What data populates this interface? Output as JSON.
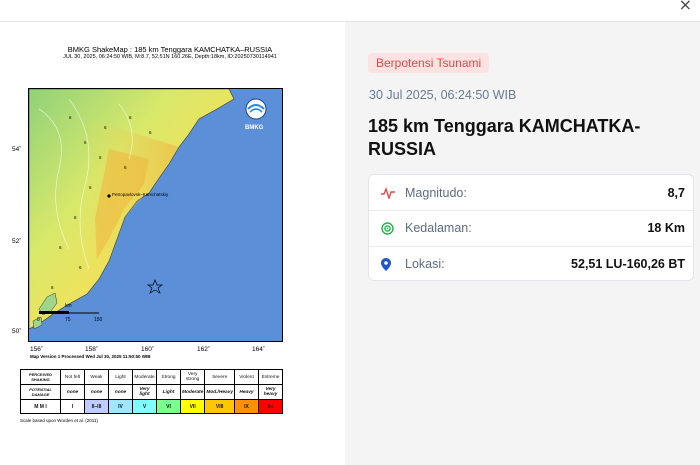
{
  "window": {
    "close_label": "×"
  },
  "shakemap": {
    "title": "BMKG ShakeMap : 185 km Tenggara KAMCHATKA–RUSSIA",
    "subtitle": "JUL 30, 2025, 06:24:50 WIB, M:8.7, 52.51N 160.26E, Depth:18km, ID:20250730114941",
    "logo_text": "BMKG",
    "city_label": "Petropavlovsk–Kamchatskiy",
    "scalebar_unit": "km",
    "scalebar_ticks": [
      "0",
      "75",
      "150"
    ],
    "lat_labels": [
      "54˚",
      "52˚",
      "50˚"
    ],
    "lon_labels": [
      "156˚",
      "158˚",
      "160˚",
      "162˚",
      "164˚"
    ],
    "contour_labels": [
      "6",
      "6",
      "6",
      "6",
      "6",
      "6",
      "6",
      "6",
      "6",
      "6",
      "6",
      "6"
    ],
    "processed_note": "Map Version 1 Processed Wed Jul 30, 2025 11:50:50 WIB",
    "scale_note": "Scale based upon Worden et al. (2011)",
    "legend": {
      "row_headers": [
        "PERCEIVED SHAKING",
        "POTENTIAL DAMAGE",
        "M M I"
      ],
      "shaking": [
        "Not felt",
        "Weak",
        "Light",
        "Moderate",
        "Strong",
        "Very strong",
        "Severe",
        "Violent",
        "Extreme"
      ],
      "damage": [
        "none",
        "none",
        "none",
        "Very light",
        "Light",
        "Moderate",
        "Mod./Heavy",
        "Heavy",
        "Very heavy"
      ],
      "mmi": [
        "I",
        "II–III",
        "IV",
        "V",
        "VI",
        "VII",
        "VIII",
        "IX",
        "X+"
      ],
      "mmi_colors": [
        "#ffffff",
        "#bfccff",
        "#a0e6ff",
        "#80ffff",
        "#7aff93",
        "#ffff00",
        "#ffc800",
        "#ff9100",
        "#ff0000"
      ]
    }
  },
  "event": {
    "badge": "Berpotensi Tsunami",
    "datetime": "30 Jul 2025, 06:24:50 WIB",
    "title": "185 km Tenggara KAMCHATKA-RUSSIA",
    "details": [
      {
        "label": "Magnitudo:",
        "value": "8,7",
        "icon": "pulse-icon",
        "color": "#e54848"
      },
      {
        "label": "Kedalaman:",
        "value": "18 Km",
        "icon": "target-icon",
        "color": "#2bb24c"
      },
      {
        "label": "Lokasi:",
        "value": "52,51 LU-160,26 BT",
        "icon": "map-pin-icon",
        "color": "#2456c8"
      }
    ]
  }
}
